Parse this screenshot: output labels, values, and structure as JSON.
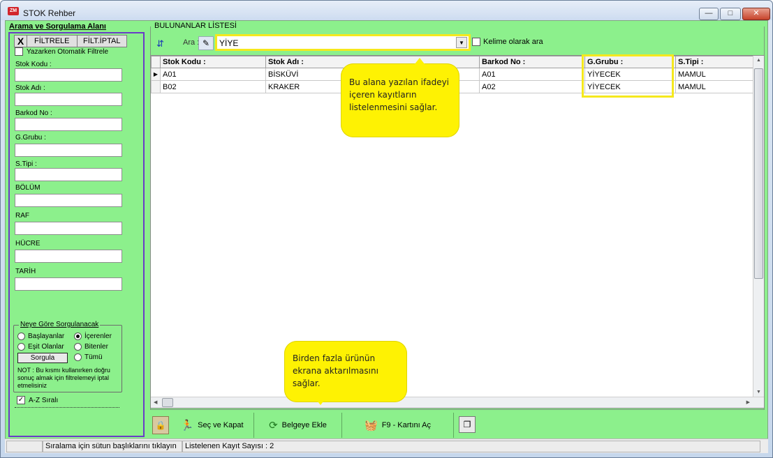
{
  "window": {
    "title": "STOK Rehber",
    "app_badge": "ZM"
  },
  "left": {
    "title": "Arama ve Sorgulama Alanı",
    "filter_x": "X",
    "filter_btn": "FİLTRELE",
    "cancel_btn": "FİLT.İPTAL",
    "auto_filter_label": "Yazarken Otomatik Filtrele",
    "fields": [
      {
        "label": "Stok Kodu :",
        "value": ""
      },
      {
        "label": "Stok Adı :",
        "value": ""
      },
      {
        "label": "Barkod No :",
        "value": ""
      },
      {
        "label": "G.Grubu :",
        "value": ""
      },
      {
        "label": "S.Tipi :",
        "value": ""
      },
      {
        "label": "BÖLÜM",
        "value": ""
      },
      {
        "label": "RAF",
        "value": ""
      },
      {
        "label": "HÜCRE",
        "value": ""
      },
      {
        "label": "TARİH",
        "value": ""
      }
    ],
    "query_group": {
      "title": "Neye Göre Sorgulanacak",
      "opt_baslayanlar": "Başlayanlar",
      "opt_icerenler": "İçerenler",
      "opt_esit": "Eşit Olanlar",
      "opt_bitenler": "Bitenler",
      "opt_tumu": "Tümü",
      "sorgula_btn": "Sorgula",
      "note": "NOT : Bu kısmı kullanırken doğru sonuç almak için filtrelemeyi iptal etmelisiniz"
    },
    "az_label": "A-Z Sıralı"
  },
  "right": {
    "legend": "BULUNANLAR LİSTESİ",
    "search_label": "Ara :",
    "search_value": "YİYE",
    "kelime_label": "Kelime olarak ara",
    "columns": [
      "Stok Kodu :",
      "Stok Adı :",
      "Barkod No :",
      "G.Grubu :",
      "S.Tipi :"
    ],
    "rows": [
      [
        "A01",
        "BİSKÜVİ",
        "A01",
        "YİYECEK",
        "MAMUL"
      ],
      [
        "B02",
        "KRAKER",
        "A02",
        "YİYECEK",
        "MAMUL"
      ]
    ]
  },
  "callouts": {
    "search_help": "Bu alana yazılan ifadeyi içeren kayıtların listelenmesini sağlar.",
    "add_help": "Birden fazla ürünün ekrana aktarılmasını sağlar."
  },
  "actions": {
    "sec_kapat": "Seç ve Kapat",
    "belgeye_ekle": "Belgeye Ekle",
    "f9_kart": "F9 - Kartını Aç"
  },
  "status": {
    "hint": "Sıralama için sütun başlıklarını tıklayın",
    "count": "Listelenen Kayıt Sayısı : 2"
  },
  "colors": {
    "client_bg": "#8cf08c",
    "highlight": "#f5e81d",
    "callout": "#fef203",
    "frame_purple": "#6a3cc7"
  },
  "icons": {
    "search_list": "search-list-icon",
    "brush": "brush-icon",
    "lock": "lock-icon",
    "sec_kapat": "running-man-icon",
    "belgeye_ekle": "refresh-icon",
    "f9": "basket-icon",
    "copy": "copy-icon"
  }
}
